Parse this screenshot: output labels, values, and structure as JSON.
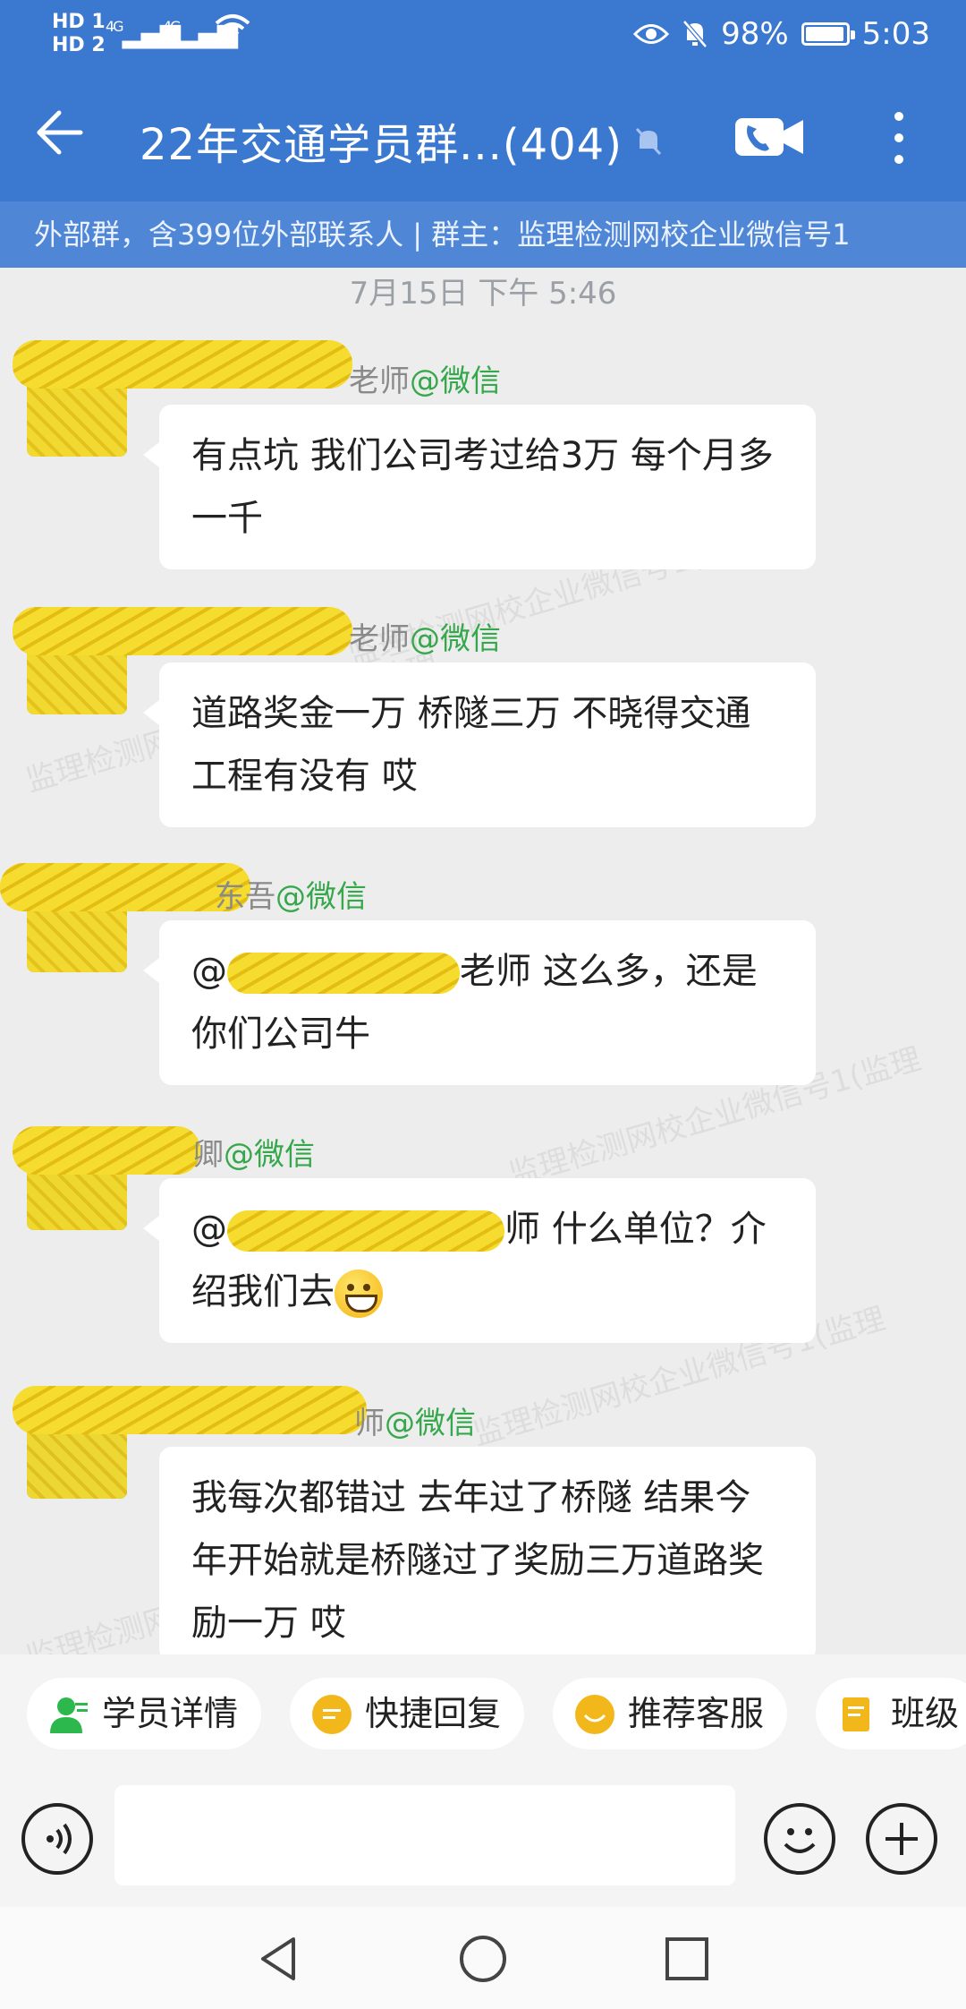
{
  "status_bar": {
    "sim1": "HD 1",
    "sim2": "HD 2",
    "net1": "4G",
    "net2": "4G",
    "battery_percent": "98%",
    "time": "5:03"
  },
  "header": {
    "title": "22年交通学员群...(404)",
    "subtitle": "外部群，含399位外部联系人 | 群主：监理检测网校企业微信号1"
  },
  "chat": {
    "timestamp": "7月15日  下午 5:46",
    "messages": [
      {
        "sender_visible": "老师",
        "source": "@微信",
        "text": "有点坑 我们公司考过给3万 每个月多一千"
      },
      {
        "sender_visible": "老师",
        "source": "@微信",
        "text": "道路奖金一万 桥隧三万 不晓得交通工程有没有 哎"
      },
      {
        "sender_visible": "东吾",
        "source": "@微信",
        "mention": "@",
        "text": "老师 这么多，还是你们公司牛"
      },
      {
        "sender_visible": "卿",
        "source": "@微信",
        "mention": "@",
        "text": "师 什么单位？介绍我们去"
      },
      {
        "sender_visible": "师",
        "source": "@微信",
        "text": "我每次都错过 去年过了桥隧 结果今年开始就是桥隧过了奖励三万道路奖励一万 哎"
      }
    ]
  },
  "quick_actions": [
    {
      "label": "学员详情",
      "icon": "student-icon",
      "color": "#2db84d"
    },
    {
      "label": "快捷回复",
      "icon": "quick-reply-icon",
      "color": "#f2b81b"
    },
    {
      "label": "推荐客服",
      "icon": "service-icon",
      "color": "#f2b81b"
    },
    {
      "label": "班级",
      "icon": "class-icon",
      "color": "#f2b81b"
    }
  ],
  "input": {
    "placeholder": ""
  },
  "watermark": "监理检测网校企业微信号1(监理",
  "colors": {
    "header_bg": "#3b78d0",
    "subbar_bg": "#4f86d6",
    "chat_bg": "#ededed",
    "source_green": "#36a84c"
  }
}
